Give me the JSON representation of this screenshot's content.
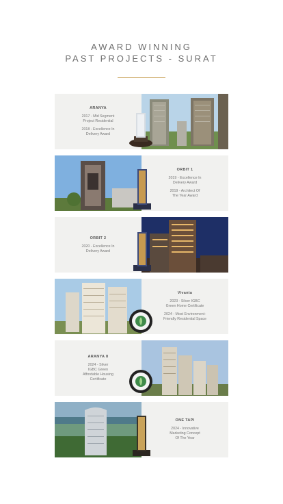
{
  "heading": {
    "line1": "AWARD WINNING",
    "line2": "PAST PROJECTS - SURAT"
  },
  "projects": [
    {
      "name": "ARANYA",
      "awards": [
        "2017 - Mid Segment\nProject Residential",
        "2018 - Excellence In\nDelivery Award"
      ]
    },
    {
      "name": "ORBIT 1",
      "awards": [
        "2019 - Excellence In\nDelivery Award",
        "2019 - Architect Of\nThe Year Award"
      ]
    },
    {
      "name": "ORBIT 2",
      "awards": [
        "2020 - Excellence In\nDelivery Award"
      ]
    },
    {
      "name": "Vivanta",
      "awards": [
        "2023 - Silver IGBC\nGreen Home Certificate",
        "2024 - Most Environment-\nFriendly Residential Space"
      ]
    },
    {
      "name": "ARANYA II",
      "awards": [
        "2024 - Silver\nIGBC Green\nAffordable Housing\nCertificate"
      ]
    },
    {
      "name": "ONE TAPI",
      "awards": [
        "2024 - Innovative\nMarketing Concept\nOf The Year"
      ]
    }
  ],
  "colors": {
    "accent": "#c9a35a",
    "card_bg": "#f1f1ef",
    "heading": "#6f6f6f"
  }
}
